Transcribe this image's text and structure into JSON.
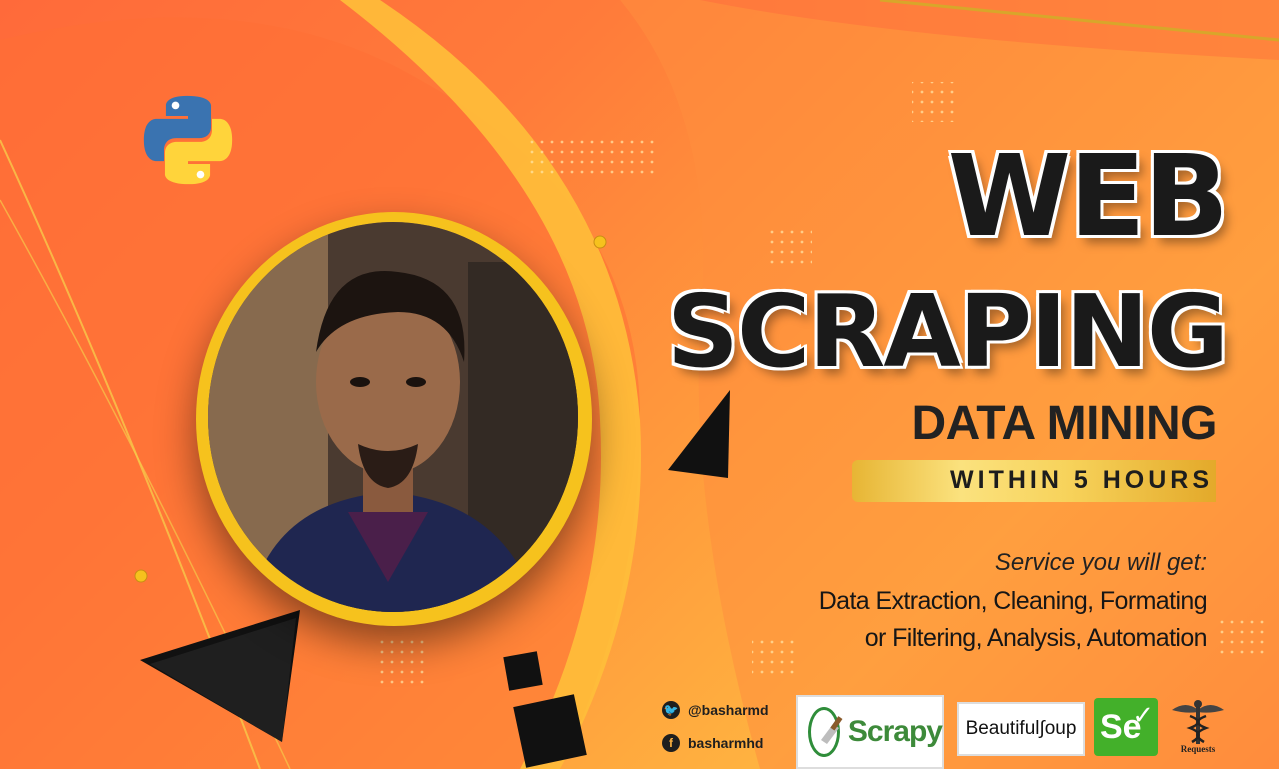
{
  "banner": {
    "title_line1": "WEB",
    "title_line2": "SCRAPING",
    "subtitle": "DATA MINING",
    "ribbon_text": "WITHIN 5 HOURS",
    "service_heading": "Service you will get:",
    "service_line1": "Data Extraction, Cleaning, Formating",
    "service_line2": "or Filtering, Analysis, Automation"
  },
  "social": {
    "twitter_handle": "@basharmd",
    "facebook_handle": "basharmhd",
    "twitter_icon": "twitter-icon",
    "facebook_icon": "facebook-icon"
  },
  "tools": {
    "scrapy_label": "Scrapy",
    "beautifulsoup_label": "Beautiful∫oup",
    "selenium_label": "Se",
    "requests_label": "Requests"
  },
  "colors": {
    "accent_orange": "#ff7a3a",
    "accent_yellow": "#f6c21d",
    "python_blue": "#3a73b0",
    "python_yellow": "#ffd43b",
    "selenium_green": "#43b02a",
    "scrapy_green": "#3d8a3a"
  }
}
